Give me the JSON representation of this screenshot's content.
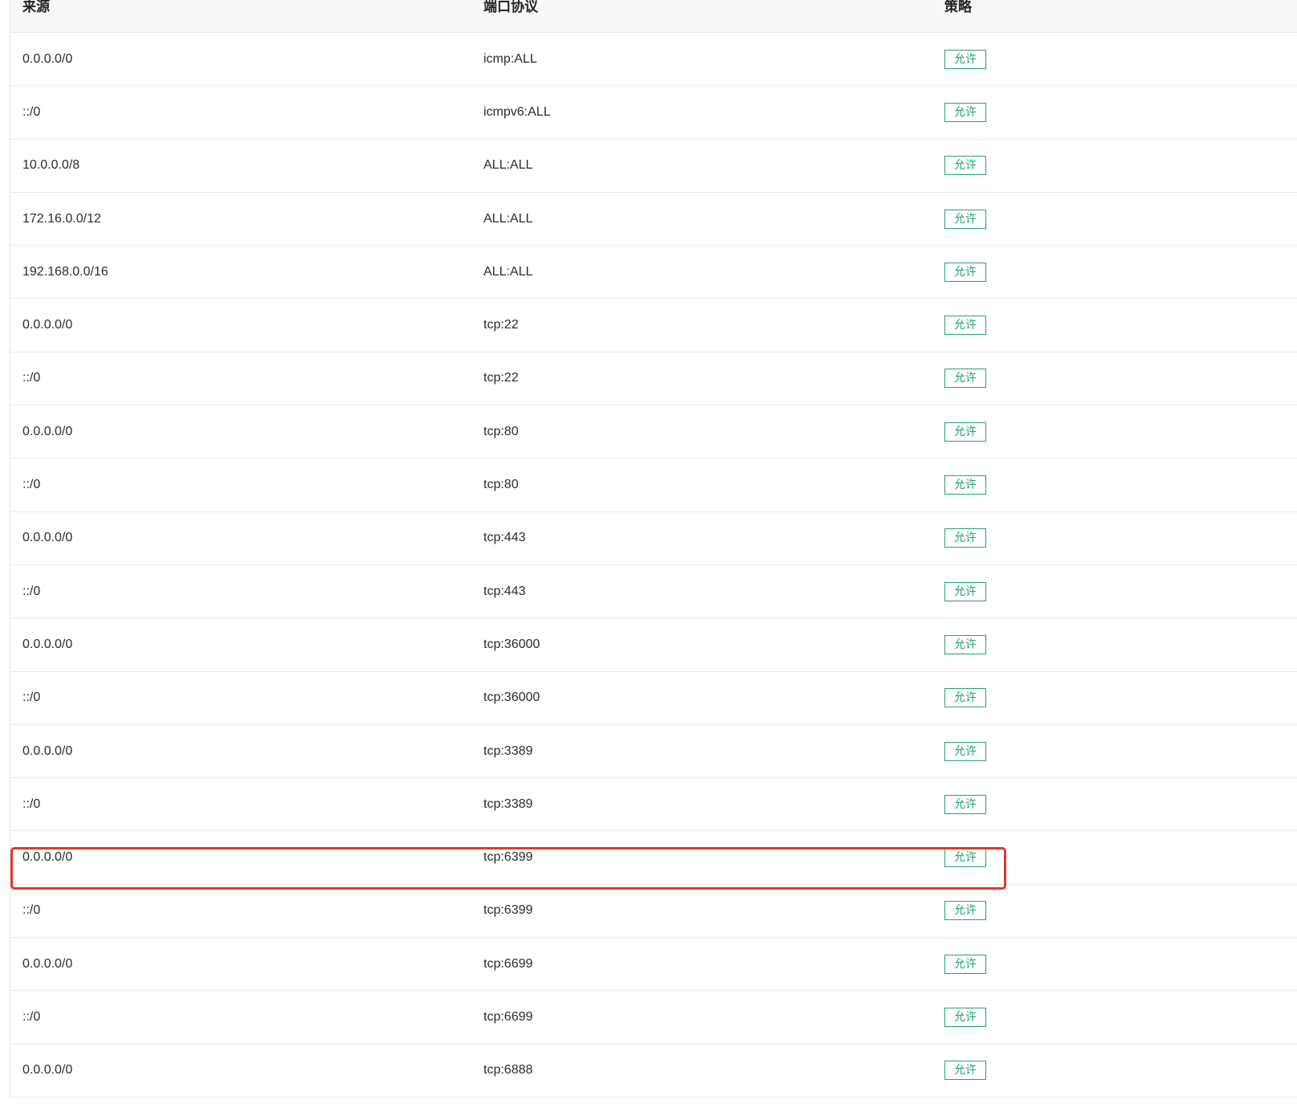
{
  "table": {
    "headers": {
      "source": "来源",
      "port_protocol": "端口协议",
      "policy": "策略"
    },
    "rows": [
      {
        "source": "0.0.0.0/0",
        "port": "icmp:ALL",
        "policy": "允许"
      },
      {
        "source": "::/0",
        "port": "icmpv6:ALL",
        "policy": "允许"
      },
      {
        "source": "10.0.0.0/8",
        "port": "ALL:ALL",
        "policy": "允许"
      },
      {
        "source": "172.16.0.0/12",
        "port": "ALL:ALL",
        "policy": "允许"
      },
      {
        "source": "192.168.0.0/16",
        "port": "ALL:ALL",
        "policy": "允许"
      },
      {
        "source": "0.0.0.0/0",
        "port": "tcp:22",
        "policy": "允许"
      },
      {
        "source": "::/0",
        "port": "tcp:22",
        "policy": "允许"
      },
      {
        "source": "0.0.0.0/0",
        "port": "tcp:80",
        "policy": "允许"
      },
      {
        "source": "::/0",
        "port": "tcp:80",
        "policy": "允许"
      },
      {
        "source": "0.0.0.0/0",
        "port": "tcp:443",
        "policy": "允许"
      },
      {
        "source": "::/0",
        "port": "tcp:443",
        "policy": "允许"
      },
      {
        "source": "0.0.0.0/0",
        "port": "tcp:36000",
        "policy": "允许"
      },
      {
        "source": "::/0",
        "port": "tcp:36000",
        "policy": "允许"
      },
      {
        "source": "0.0.0.0/0",
        "port": "tcp:3389",
        "policy": "允许"
      },
      {
        "source": "::/0",
        "port": "tcp:3389",
        "policy": "允许"
      },
      {
        "source": "0.0.0.0/0",
        "port": "tcp:6399",
        "policy": "允许"
      },
      {
        "source": "::/0",
        "port": "tcp:6399",
        "policy": "允许"
      },
      {
        "source": "0.0.0.0/0",
        "port": "tcp:6699",
        "policy": "允许"
      },
      {
        "source": "::/0",
        "port": "tcp:6699",
        "policy": "允许"
      },
      {
        "source": "0.0.0.0/0",
        "port": "tcp:6888",
        "policy": "允许"
      }
    ]
  },
  "highlight": {
    "row_number": 16,
    "color": "#e0392b"
  },
  "colors": {
    "allow_badge": "#23a36b",
    "header_bg": "#f7f8fa"
  }
}
